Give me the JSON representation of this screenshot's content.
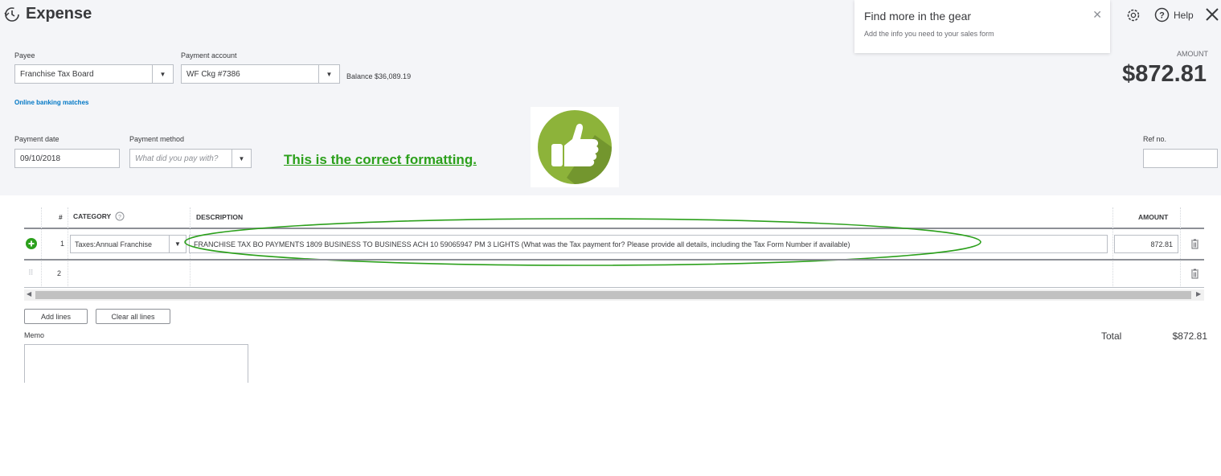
{
  "header": {
    "title": "Expense",
    "help": "Help"
  },
  "tip": {
    "title": "Find more in the gear",
    "text": "Add the info you need to your sales form"
  },
  "payee": {
    "label": "Payee",
    "value": "Franchise Tax Board"
  },
  "payment_account": {
    "label": "Payment account",
    "value": "WF Ckg #7386",
    "balance": "Balance $36,089.19"
  },
  "online_banking": "Online banking matches",
  "amount": {
    "label": "AMOUNT",
    "value": "$872.81"
  },
  "payment_date": {
    "label": "Payment date",
    "value": "09/10/2018"
  },
  "payment_method": {
    "label": "Payment method",
    "placeholder": "What did you pay with?"
  },
  "ref_no": {
    "label": "Ref no."
  },
  "annotation": {
    "note": "This is the correct formatting.",
    "accent": "#2ca01c"
  },
  "table": {
    "headers": {
      "num": "#",
      "category": "CATEGORY",
      "description": "DESCRIPTION",
      "amount": "AMOUNT"
    },
    "rows": [
      {
        "num": "1",
        "category": "Taxes:Annual Franchise",
        "description": "FRANCHISE TAX BO PAYMENTS 1809 BUSINESS TO BUSINESS ACH 10 59065947 PM 3 LIGHTS  (What was the Tax payment for?  Please provide all details, including the Tax Form Number if available)",
        "amount": "872.81"
      },
      {
        "num": "2",
        "category": "",
        "description": "",
        "amount": ""
      }
    ]
  },
  "buttons": {
    "add_lines": "Add lines",
    "clear_all": "Clear all lines"
  },
  "memo": {
    "label": "Memo"
  },
  "total": {
    "label": "Total",
    "value": "$872.81"
  },
  "colors": {
    "brand_green": "#2ca01c",
    "header_bg": "#f4f5f8",
    "link_blue": "#0077c5"
  }
}
